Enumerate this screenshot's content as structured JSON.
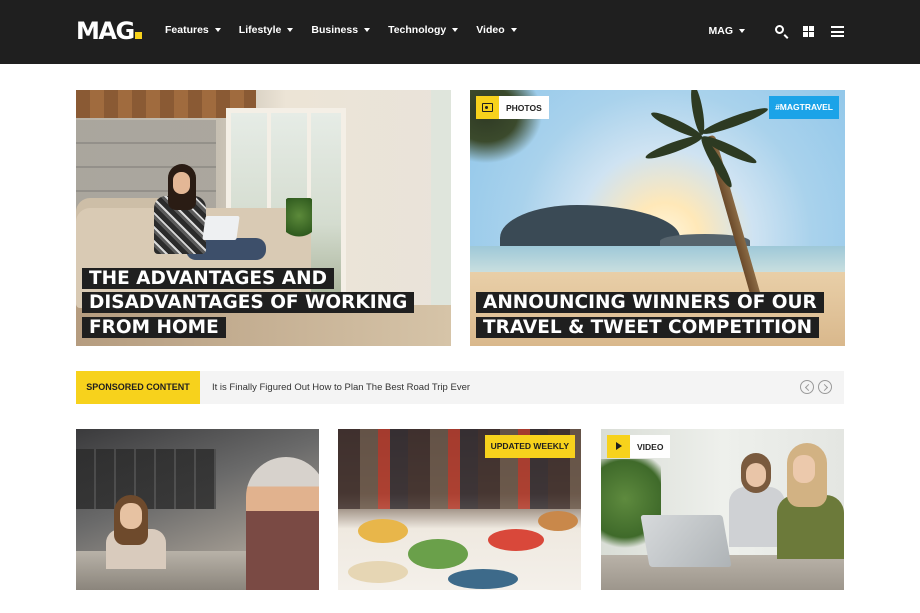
{
  "header": {
    "logo": "MAG",
    "nav": [
      {
        "label": "Features"
      },
      {
        "label": "Lifestyle"
      },
      {
        "label": "Business"
      },
      {
        "label": "Technology"
      },
      {
        "label": "Video"
      }
    ],
    "edition_selector": "MAG",
    "icons": [
      "search-icon",
      "grid-icon",
      "menu-icon"
    ]
  },
  "featured": [
    {
      "title": "THE ADVANTAGES AND DISADVANTAGES OF WORKING FROM HOME"
    },
    {
      "category_badge": "PHOTOS",
      "tag": "#MAGTRAVEL",
      "title": "ANNOUNCING WINNERS OF OUR TRAVEL & TWEET COMPETITION"
    }
  ],
  "sponsored": {
    "label": "SPONSORED CONTENT",
    "headline": "It is Finally Figured Out How to Plan The Best Road Trip Ever"
  },
  "cards": [
    {
      "badge": ""
    },
    {
      "badge": "UPDATED WEEKLY"
    },
    {
      "badge": "VIDEO"
    }
  ],
  "colors": {
    "header_bg": "#1f1f1f",
    "accent_yellow": "#f7d21c",
    "tag_blue": "#1ba3e8",
    "bar_bg": "#f4f4f4"
  }
}
